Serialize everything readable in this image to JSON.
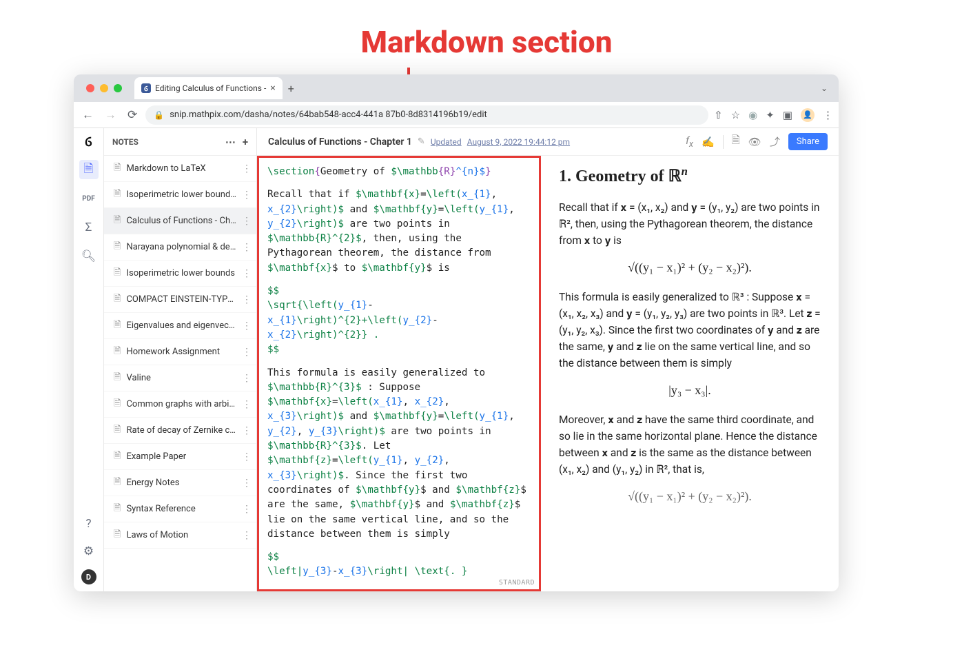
{
  "annotation": {
    "label": "Markdown section"
  },
  "browser": {
    "tab_title": "Editing Calculus of Functions -",
    "url": "snip.mathpix.com/dasha/notes/64bab548-acc4-441a 87b0-8d8314196b19/edit"
  },
  "sidebar": {
    "header": "NOTES",
    "items": [
      {
        "title": "Markdown to LaTeX"
      },
      {
        "title": "Isoperimetric lower bounds…"
      },
      {
        "title": "Calculus of Functions - Cha…",
        "active": true
      },
      {
        "title": "Narayana polynomial & der…"
      },
      {
        "title": "Isoperimetric lower bounds"
      },
      {
        "title": "COMPACT EINSTEIN-TYPE M…"
      },
      {
        "title": "Eigenvalues and eigenvectors"
      },
      {
        "title": "Homework Assignment"
      },
      {
        "title": "Valine"
      },
      {
        "title": "Common graphs with arbitr…"
      },
      {
        "title": "Rate of decay of Zernike co…"
      },
      {
        "title": "Example Paper"
      },
      {
        "title": "Energy Notes"
      },
      {
        "title": "Syntax Reference"
      },
      {
        "title": "Laws of Motion"
      }
    ]
  },
  "doc": {
    "title": "Calculus of Functions - Chapter 1",
    "updated_label": "Updated",
    "updated_time": "August 9, 2022 19:44:12 pm",
    "share": "Share"
  },
  "editor": {
    "section_cmd": "\\section",
    "section_text": "Geometry of ",
    "section_math_cmd": "$\\mathbb",
    "section_math_arg": "{R}",
    "section_exp": "^{n}$",
    "p1_pre": "Recall that if ",
    "p1_mx": "$\\mathbf{x}",
    "p1_eq": "=",
    "p1_left": "\\left(",
    "p1_x1": "x_{1}",
    "p1_comma": ", ",
    "p1_x2": "x_{2}",
    "p1_right": "\\right)$",
    "p1_and": "and ",
    "p1_my": "$\\mathbf{y}",
    "p1_y1": "y_{1}",
    "p1_y2": "y_{2}",
    "p1_are": " are two points in ",
    "p1_r2": "$\\mathbb{R}^{2}$",
    "p1_then": ", then, using the Pythagorean theorem, the distance from ",
    "p1_to": " to ",
    "p1_is": " is",
    "disp_open": "$$",
    "disp_body_a": "\\sqrt{\\left(",
    "disp_y1": "y_{1}",
    "disp_minus": "-",
    "disp_x1": "x_{1}",
    "disp_mid": "\\right)^{2}+\\left(",
    "disp_y2": "y_{2}",
    "disp_x2": "x_{2}",
    "disp_end": "\\right)^{2}} .",
    "disp_close": "$$",
    "p2_pre": "This formula is easily generalized to ",
    "p2_r3": "$\\mathbb{R}^{3}$",
    "p2_suppose": " : Suppose ",
    "p2_x3": "x_{3}",
    "p2_y3": "y_{3}",
    "p2_and": " and ",
    "p2_are2pts": " are two points in ",
    "p2_let": ". Let ",
    "p2_mz": "$\\mathbf{z}",
    "p2_since": ". Since the first two coordinates of ",
    "p2_andz": " and ",
    "p2_same": " are the same, ",
    "p2_lie": " lie on the same vertical line, and so the distance between them is simply",
    "disp2_body_a": "\\left|",
    "disp2_body_b": "\\right| \\text{. }",
    "standard": "STANDARD"
  },
  "preview": {
    "h_prefix": "1. Geometry of ",
    "h_rn_base": "ℝ",
    "h_rn_exp": "n",
    "p1": "Recall that if 𝐱 = (x₁, x₂) and 𝐲 = (y₁, y₂) are two points in ℝ², then, using the Pythagorean theorem, the distance from 𝐱 to 𝐲 is",
    "eq1": "√((y₁ − x₁)² + (y₂ − x₂)²).",
    "p2": "This formula is easily generalized to ℝ³ : Suppose 𝐱 = (x₁, x₂, x₃) and 𝐲 = (y₁, y₂, y₃) are two points in ℝ³. Let 𝐳 = (y₁, y₂, x₃). Since the first two coordinates of 𝐲 and 𝐳 are the same, 𝐲 and 𝐳 lie on the same vertical line, and so the distance between them is simply",
    "eq2": "|y₃ − x₃|.",
    "p3": "Moreover, 𝐱 and 𝐳 have the same third coordinate, and so lie in the same horizontal plane. Hence the distance between 𝐱 and 𝐳 is the same as the distance between (x₁, x₂) and (y₁, y₂) in ℝ², that is,",
    "eq3": "√((y₁ − x₁)² + (y₂ − x₂)²)."
  }
}
